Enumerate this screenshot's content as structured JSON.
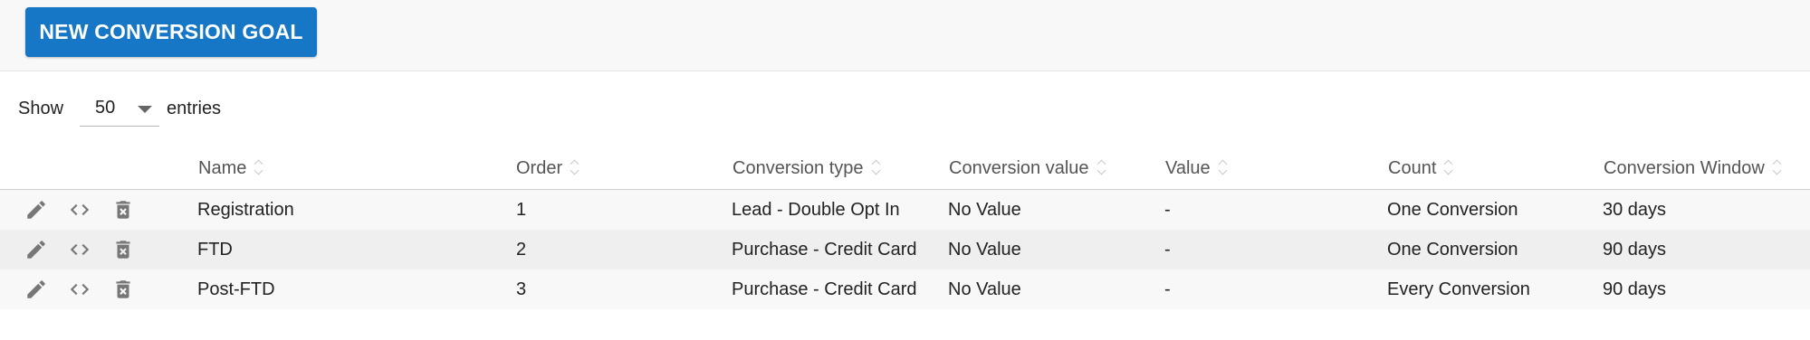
{
  "toolbar": {
    "new_goal_label": "NEW CONVERSION GOAL"
  },
  "length": {
    "show_label": "Show",
    "value": "50",
    "entries_label": "entries"
  },
  "table": {
    "columns": [
      {
        "key": "name",
        "label": "Name"
      },
      {
        "key": "order",
        "label": "Order"
      },
      {
        "key": "conversion_type",
        "label": "Conversion type"
      },
      {
        "key": "conversion_value",
        "label": "Conversion value"
      },
      {
        "key": "value",
        "label": "Value"
      },
      {
        "key": "count",
        "label": "Count"
      },
      {
        "key": "conversion_window",
        "label": "Conversion Window"
      }
    ],
    "rows": [
      {
        "name": "Registration",
        "order": "1",
        "conversion_type": "Lead - Double Opt In",
        "conversion_value": "No Value",
        "value": "-",
        "count": "One Conversion",
        "conversion_window": "30 days"
      },
      {
        "name": "FTD",
        "order": "2",
        "conversion_type": "Purchase - Credit Card",
        "conversion_value": "No Value",
        "value": "-",
        "count": "One Conversion",
        "conversion_window": "90 days"
      },
      {
        "name": "Post-FTD",
        "order": "3",
        "conversion_type": "Purchase - Credit Card",
        "conversion_value": "No Value",
        "value": "-",
        "count": "Every Conversion",
        "conversion_window": "90 days"
      }
    ]
  },
  "icons": {
    "edit": "pencil-icon",
    "code": "code-icon",
    "delete": "trash-icon"
  },
  "colors": {
    "primary": "#1677c6",
    "row_odd": "#f8f8f8",
    "row_even": "#efefef",
    "icon": "#777777"
  }
}
